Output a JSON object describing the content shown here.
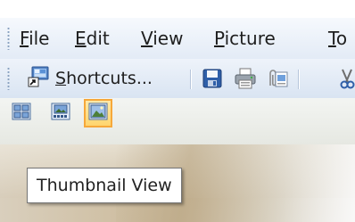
{
  "menu": {
    "items": [
      {
        "prefix": "",
        "hotkey": "F",
        "rest": "ile"
      },
      {
        "prefix": "",
        "hotkey": "E",
        "rest": "dit"
      },
      {
        "prefix": "",
        "hotkey": "V",
        "rest": "iew"
      },
      {
        "prefix": "",
        "hotkey": "P",
        "rest": "icture"
      },
      {
        "prefix": "",
        "hotkey": "T",
        "rest": "o"
      }
    ]
  },
  "toolbar": {
    "shortcuts_hotkey": "S",
    "shortcuts_rest": "hortcuts...",
    "icons": [
      "shortcuts-icon",
      "save-icon",
      "print-icon",
      "attach-icon",
      "cut-icon"
    ]
  },
  "view_modes": {
    "buttons": [
      "filmstrip-view-icon",
      "slideshow-view-icon",
      "thumbnail-view-icon"
    ],
    "active": "thumbnail-view-icon"
  },
  "tooltip": {
    "text": "Thumbnail View"
  }
}
